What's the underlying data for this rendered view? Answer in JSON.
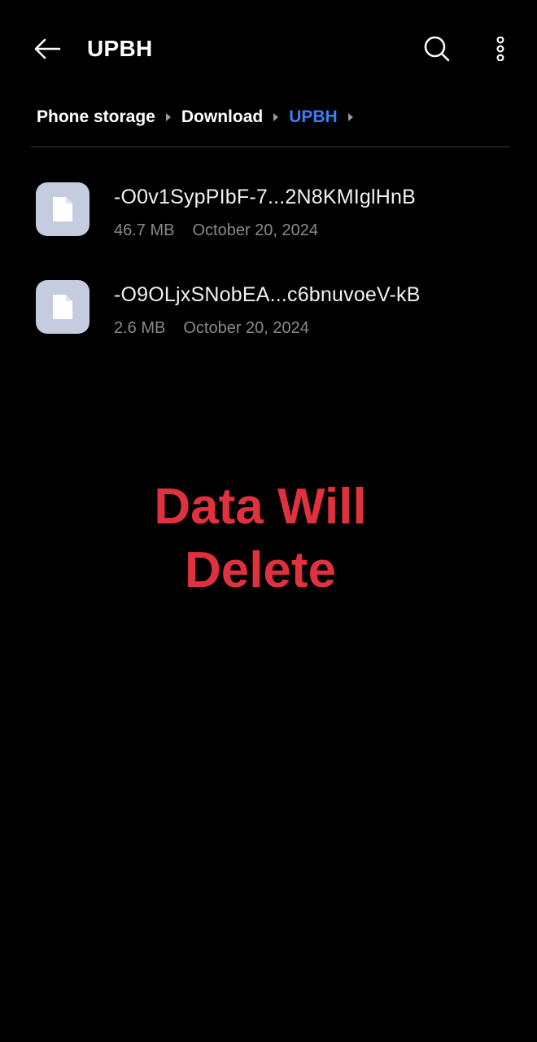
{
  "header": {
    "title": "UPBH"
  },
  "breadcrumb": {
    "items": [
      {
        "label": "Phone storage",
        "active": false
      },
      {
        "label": "Download",
        "active": false
      },
      {
        "label": "UPBH",
        "active": true
      }
    ]
  },
  "files": [
    {
      "name": "-O0v1SypPIbF-7...2N8KMIglHnB",
      "size": "46.7 MB",
      "date": "October 20, 2024"
    },
    {
      "name": "-O9OLjxSNobEA...c6bnuvoeV-kB",
      "size": "2.6 MB",
      "date": "October 20, 2024"
    }
  ],
  "overlay": {
    "line1": "Data Will",
    "line2": "Delete"
  },
  "icons": {
    "back": "back-arrow-icon",
    "search": "search-icon",
    "more": "more-vertical-icon",
    "file": "file-icon",
    "separator": "chevron-right-icon"
  },
  "colors": {
    "background": "#000000",
    "accent": "#3d7ef0",
    "overlay_text": "#e0313f",
    "thumb": "#c5cce0",
    "meta_text": "#8a8a8a"
  }
}
